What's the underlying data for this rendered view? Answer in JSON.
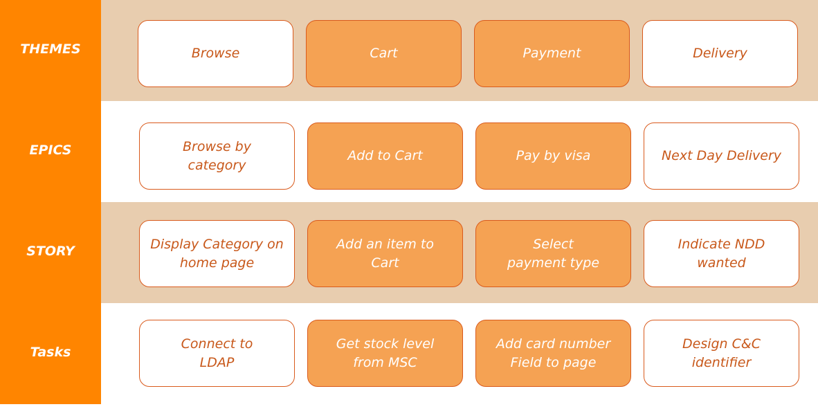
{
  "rows": [
    {
      "label": "THEMES",
      "cards": [
        {
          "text": "Browse",
          "style": "outline"
        },
        {
          "text": "Cart",
          "style": "filled"
        },
        {
          "text": "Payment",
          "style": "filled"
        },
        {
          "text": "Delivery",
          "style": "outline"
        }
      ]
    },
    {
      "label": "EPICS",
      "cards": [
        {
          "text": "Browse by\ncategory",
          "style": "outline"
        },
        {
          "text": "Add to Cart",
          "style": "filled"
        },
        {
          "text": "Pay by visa",
          "style": "filled"
        },
        {
          "text": "Next Day Delivery",
          "style": "outline"
        }
      ]
    },
    {
      "label": "STORY",
      "cards": [
        {
          "text": "Display Category on\nhome page",
          "style": "outline"
        },
        {
          "text": "Add an item to\nCart",
          "style": "filled"
        },
        {
          "text": "Select\npayment type",
          "style": "filled"
        },
        {
          "text": "Indicate NDD\nwanted",
          "style": "outline"
        }
      ]
    },
    {
      "label": "Tasks",
      "cards": [
        {
          "text": "Connect to\nLDAP",
          "style": "outline"
        },
        {
          "text": "Get stock level\nfrom MSC",
          "style": "filled"
        },
        {
          "text": "Add card number\nField to page",
          "style": "filled"
        },
        {
          "text": "Design C&C\nidentifier",
          "style": "outline"
        }
      ]
    }
  ],
  "colors": {
    "sidebar": "#ff8500",
    "band_tan": "#e8cdaf",
    "card_border": "#d95a1c",
    "card_fill": "#f5a253",
    "outline_text": "#c8581a"
  }
}
